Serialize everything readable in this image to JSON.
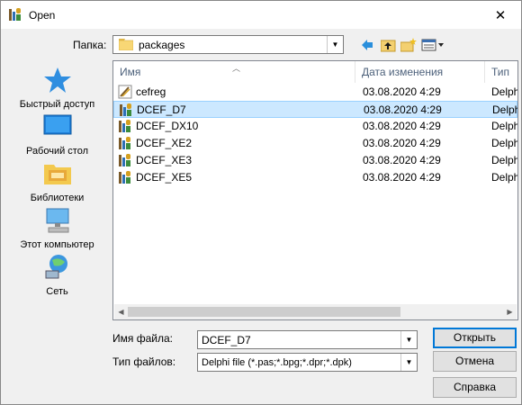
{
  "window": {
    "title": "Open",
    "close_glyph": "✕"
  },
  "lookin": {
    "label": "Папка:",
    "value": "packages"
  },
  "toolbar": {
    "icons": [
      "back-arrow-icon",
      "up-folder-icon",
      "new-folder-icon",
      "view-menu-icon"
    ]
  },
  "places": [
    {
      "label": "Быстрый доступ",
      "icon": "quick-access-star-icon"
    },
    {
      "label": "Рабочий стол",
      "icon": "desktop-icon"
    },
    {
      "label": "Библиотеки",
      "icon": "libraries-icon"
    },
    {
      "label": "Этот компьютер",
      "icon": "this-pc-icon"
    },
    {
      "label": "Сеть",
      "icon": "network-icon"
    }
  ],
  "file_list": {
    "columns": [
      "Имя",
      "Дата изменения",
      "Тип"
    ],
    "rows": [
      {
        "name": "cefreg",
        "date": "",
        "type": "",
        "icon": "delphi-project-icon",
        "selected": false
      },
      {
        "name": "DCEF_D7",
        "date": "03.08.2020 4:29",
        "type": "Delph",
        "icon": "delphi-package-icon",
        "selected": true
      },
      {
        "name": "DCEF_DX10",
        "date": "03.08.2020 4:29",
        "type": "Delph",
        "icon": "delphi-package-icon",
        "selected": false
      },
      {
        "name": "DCEF_XE2",
        "date": "03.08.2020 4:29",
        "type": "Delph",
        "icon": "delphi-package-icon",
        "selected": false
      },
      {
        "name": "DCEF_XE3",
        "date": "03.08.2020 4:29",
        "type": "Delph",
        "icon": "delphi-package-icon",
        "selected": false
      },
      {
        "name": "DCEF_XE5",
        "date": "03.08.2020 4:29",
        "type": "Delph",
        "icon": "delphi-package-icon",
        "selected": false
      }
    ],
    "first_row_type": "Delph",
    "first_row_date": "03.08.2020 4:29"
  },
  "filename": {
    "label": "Имя файла:",
    "value": "DCEF_D7"
  },
  "filetype": {
    "label": "Тип файлов:",
    "value": "Delphi file (*.pas;*.bpg;*.dpr;*.dpk)"
  },
  "buttons": {
    "open": "Открыть",
    "cancel": "Отмена",
    "help": "Справка"
  },
  "colors": {
    "selection": "#cce8ff",
    "selection_border": "#99d1ff",
    "accent": "#0078d7"
  }
}
